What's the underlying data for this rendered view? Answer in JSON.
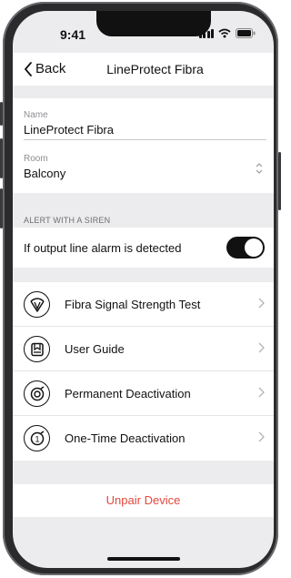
{
  "status_bar": {
    "time": "9:41"
  },
  "nav": {
    "back_label": "Back",
    "title": "LineProtect Fibra"
  },
  "name_field": {
    "label": "Name",
    "value": "LineProtect Fibra"
  },
  "room_field": {
    "label": "Room",
    "value": "Balcony"
  },
  "siren_section": {
    "header": "ALERT WITH A SIREN",
    "toggle_label": "If output line alarm is detected",
    "toggle_on": true
  },
  "menu": {
    "items": [
      {
        "label": "Fibra Signal Strength Test",
        "icon": "signal-strength-icon"
      },
      {
        "label": "User Guide",
        "icon": "user-guide-icon"
      },
      {
        "label": "Permanent Deactivation",
        "icon": "permanent-deactivation-icon"
      },
      {
        "label": "One-Time Deactivation",
        "icon": "one-time-deactivation-icon"
      }
    ]
  },
  "unpair": {
    "label": "Unpair Device"
  },
  "colors": {
    "accent_red": "#e2483d",
    "toggle_on": "#111111",
    "background": "#ececee"
  }
}
